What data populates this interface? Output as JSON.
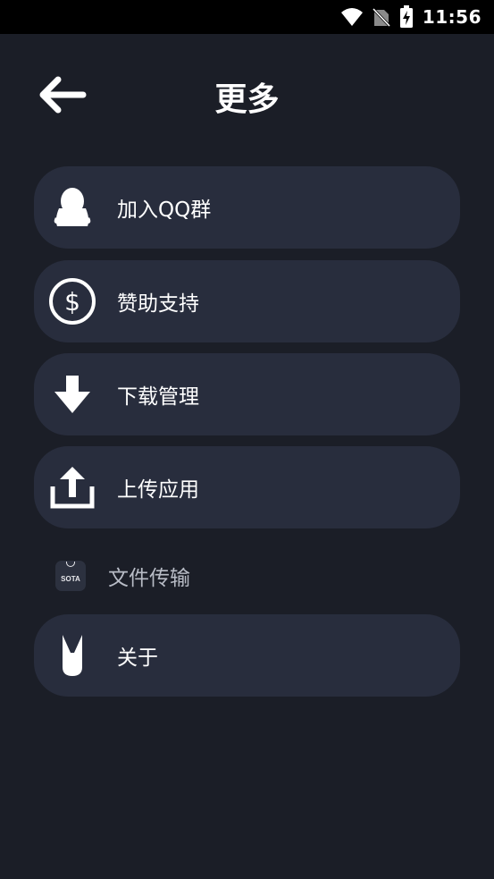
{
  "status_bar": {
    "time": "11:56",
    "icons": [
      "wifi-icon",
      "no-sim-icon",
      "battery-charging-icon"
    ]
  },
  "header": {
    "title": "更多",
    "back_icon": "arrow-left-icon"
  },
  "menu": {
    "items": [
      {
        "label": "加入QQ群",
        "icon": "qq-penguin-icon"
      },
      {
        "label": "赞助支持",
        "icon": "dollar-circle-icon"
      },
      {
        "label": "下载管理",
        "icon": "download-arrow-icon"
      },
      {
        "label": "上传应用",
        "icon": "upload-icon"
      },
      {
        "label": "文件传输",
        "icon": "sota-app-icon",
        "icon_text": "SOTA"
      },
      {
        "label": "关于",
        "icon": "about-logo-icon"
      }
    ]
  },
  "colors": {
    "background": "#1b1e27",
    "card": "#282d3d",
    "text": "#ffffff",
    "muted_text": "#b8bcc6"
  }
}
